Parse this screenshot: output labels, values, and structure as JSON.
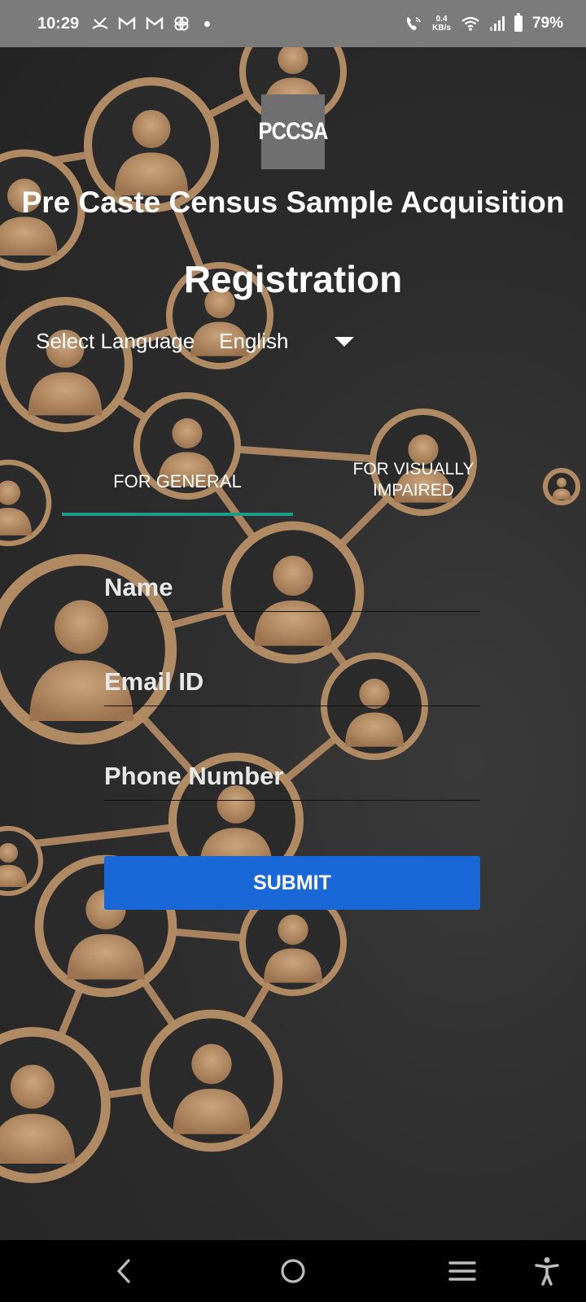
{
  "status_bar": {
    "time": "10:29",
    "speed_value": "0.4",
    "speed_unit": "KB/s",
    "battery": "79%"
  },
  "logo": {
    "text": "PCCSA"
  },
  "header": {
    "app_title": "Pre Caste Census Sample Acquisition",
    "page_title": "Registration"
  },
  "language": {
    "label": "Select Language",
    "selected": "English"
  },
  "tabs": [
    {
      "label": "FOR GENERAL",
      "active": true
    },
    {
      "label": "FOR VISUALLY IMPAIRED",
      "active": false
    }
  ],
  "form": {
    "name_placeholder": "Name",
    "email_placeholder": "Email ID",
    "phone_placeholder": "Phone Number",
    "submit_label": "SUBMIT"
  },
  "colors": {
    "accent_tab": "#1c9d87",
    "submit": "#1a68d8",
    "status_bar": "#7b7b7b",
    "wood": "#b08a63"
  },
  "nav": {
    "icons": [
      "back-icon",
      "home-icon",
      "recents-icon",
      "accessibility-icon"
    ]
  }
}
